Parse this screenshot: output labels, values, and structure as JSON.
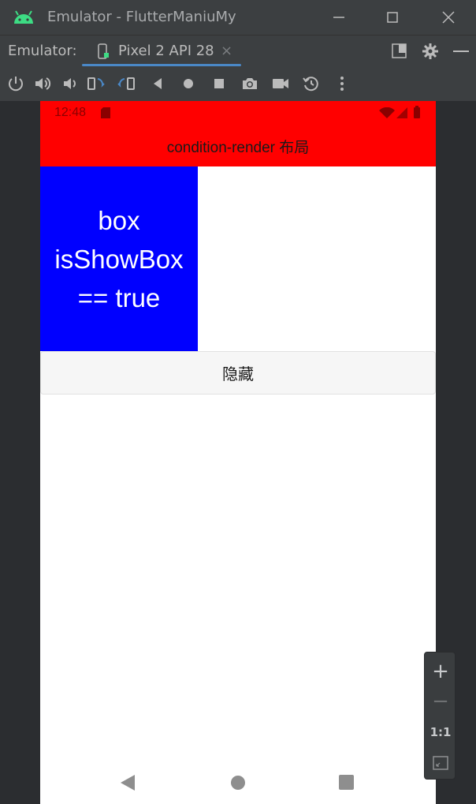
{
  "window": {
    "title": "Emulator - FlutterManiuMy"
  },
  "tabbar": {
    "label": "Emulator:",
    "device_tab": "Pixel 2 API 28",
    "close_glyph": "×"
  },
  "toolbar": {
    "icons": [
      "power-icon",
      "volume-up-icon",
      "volume-down-icon",
      "rotate-left-icon",
      "rotate-right-icon",
      "back-icon",
      "home-icon",
      "overview-icon",
      "screenshot-icon",
      "screenrecord-icon",
      "snapshot-icon",
      "more-icon"
    ]
  },
  "status_bar": {
    "time": "12:48"
  },
  "app": {
    "title": "condition-render 布局",
    "box_lines": [
      "box",
      "isShowBox",
      "== true"
    ],
    "button_label": "隐藏"
  },
  "zoom": {
    "plus": "+",
    "minus": "−",
    "one_to_one": "1:1"
  },
  "colors": {
    "appbar": "#ff0000",
    "box": "#0000ff",
    "accent": "#4a88c7",
    "android_green": "#3ddc84"
  }
}
